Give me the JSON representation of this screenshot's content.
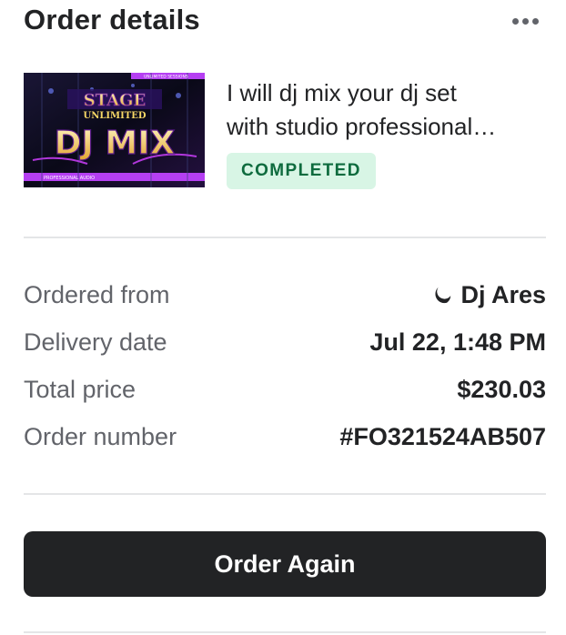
{
  "header": {
    "title": "Order details",
    "more_icon": "more-horizontal-icon"
  },
  "gig": {
    "thumbnail": {
      "alt_text_lines": [
        "STAGE",
        "UNLIMITED",
        "DJ MIX"
      ],
      "footer_text": "PROFESSIONAL AUDIO",
      "corner_text": "UNLIMITED SESSIONS"
    },
    "title_line_1": "I will dj mix your dj set",
    "title_line_2": "with studio professional…",
    "status": "COMPLETED"
  },
  "details": {
    "ordered_from_label": "Ordered from",
    "ordered_from_value": "Dj Ares",
    "seller_icon": "moon-icon",
    "delivery_date_label": "Delivery date",
    "delivery_date_value": "Jul 22, 1:48 PM",
    "total_price_label": "Total price",
    "total_price_value": "$230.03",
    "order_number_label": "Order number",
    "order_number_value": "#FO321524AB507"
  },
  "actions": {
    "order_again_label": "Order Again"
  },
  "colors": {
    "text_primary": "#222325",
    "text_secondary": "#62646a",
    "badge_bg": "#d8f5e5",
    "badge_text": "#0e6b3e",
    "button_bg": "#222325",
    "divider": "#e4e5e7"
  }
}
